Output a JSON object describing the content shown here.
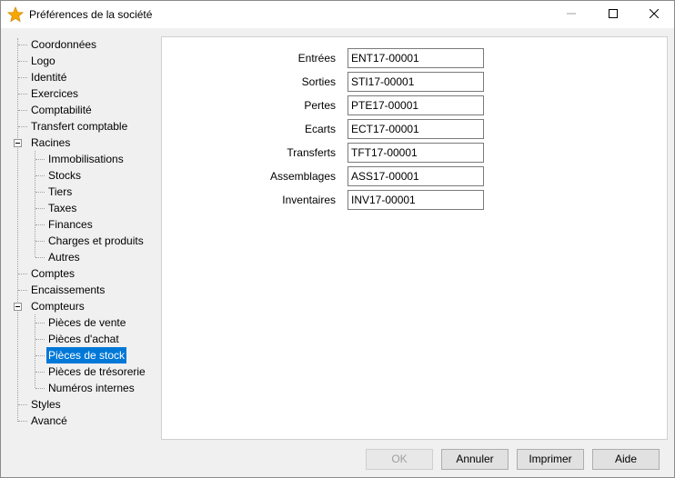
{
  "window": {
    "title": "Préférences de la société",
    "accent": "#0078d7"
  },
  "tree": {
    "items": [
      {
        "label": "Coordonnées"
      },
      {
        "label": "Logo"
      },
      {
        "label": "Identité"
      },
      {
        "label": "Exercices"
      },
      {
        "label": "Comptabilité"
      },
      {
        "label": "Transfert comptable"
      },
      {
        "label": "Racines",
        "expanded": true
      },
      {
        "label": "Immobilisations"
      },
      {
        "label": "Stocks"
      },
      {
        "label": "Tiers"
      },
      {
        "label": "Taxes"
      },
      {
        "label": "Finances"
      },
      {
        "label": "Charges et produits"
      },
      {
        "label": "Autres"
      },
      {
        "label": "Comptes"
      },
      {
        "label": "Encaissements"
      },
      {
        "label": "Compteurs",
        "expanded": true
      },
      {
        "label": "Pièces de vente"
      },
      {
        "label": "Pièces d'achat"
      },
      {
        "label": "Pièces de stock",
        "selected": true
      },
      {
        "label": "Pièces de trésorerie"
      },
      {
        "label": "Numéros internes"
      },
      {
        "label": "Styles"
      },
      {
        "label": "Avancé"
      }
    ]
  },
  "form": {
    "fields": [
      {
        "label": "Entrées",
        "value": "ENT17-00001"
      },
      {
        "label": "Sorties",
        "value": "STI17-00001"
      },
      {
        "label": "Pertes",
        "value": "PTE17-00001"
      },
      {
        "label": "Ecarts",
        "value": "ECT17-00001"
      },
      {
        "label": "Transferts",
        "value": "TFT17-00001"
      },
      {
        "label": "Assemblages",
        "value": "ASS17-00001"
      },
      {
        "label": "Inventaires",
        "value": "INV17-00001"
      }
    ]
  },
  "buttons": {
    "ok": "OK",
    "cancel": "Annuler",
    "print": "Imprimer",
    "help": "Aide"
  },
  "icons": {
    "title": "star-icon",
    "minimize": "minimize-icon",
    "maximize": "maximize-icon",
    "close": "close-icon"
  }
}
